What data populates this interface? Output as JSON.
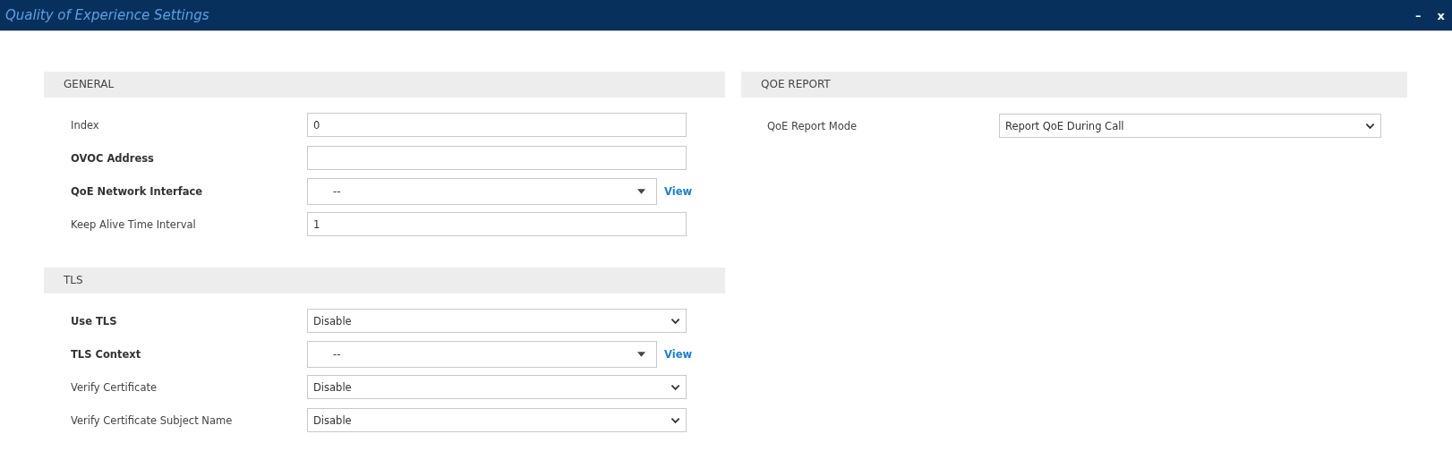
{
  "window": {
    "title": "Quality of Experience Settings",
    "controls": [
      "–",
      "x"
    ]
  },
  "columns": [
    {
      "sections": [
        {
          "title": "GENERAL",
          "fields": [
            {
              "label": "Index",
              "bold": false,
              "kind": "text",
              "value": "0"
            },
            {
              "label": "OVOC Address",
              "bold": true,
              "kind": "text"
            },
            {
              "label": "QoE Network Interface",
              "bold": true,
              "kind": "combo",
              "value": "--",
              "link": "View"
            },
            {
              "label": "Keep Alive Time Interval",
              "bold": false,
              "kind": "text",
              "value": "1"
            }
          ]
        },
        {
          "title": "TLS",
          "fields": [
            {
              "label": "Use TLS",
              "bold": true,
              "kind": "select",
              "value": "Disable"
            },
            {
              "label": "TLS Context",
              "bold": true,
              "kind": "combo",
              "value": "--",
              "link": "View"
            },
            {
              "label": "Verify Certificate",
              "bold": false,
              "kind": "select",
              "value": "Disable"
            },
            {
              "label": "Verify Certificate Subject Name",
              "bold": false,
              "kind": "select",
              "value": "Disable"
            }
          ]
        }
      ]
    },
    {
      "sections": [
        {
          "title": "QOE REPORT",
          "fields": [
            {
              "label": "QoE Report Mode",
              "bold": false,
              "kind": "select",
              "value": "Report QoE During Call"
            }
          ]
        }
      ]
    }
  ]
}
